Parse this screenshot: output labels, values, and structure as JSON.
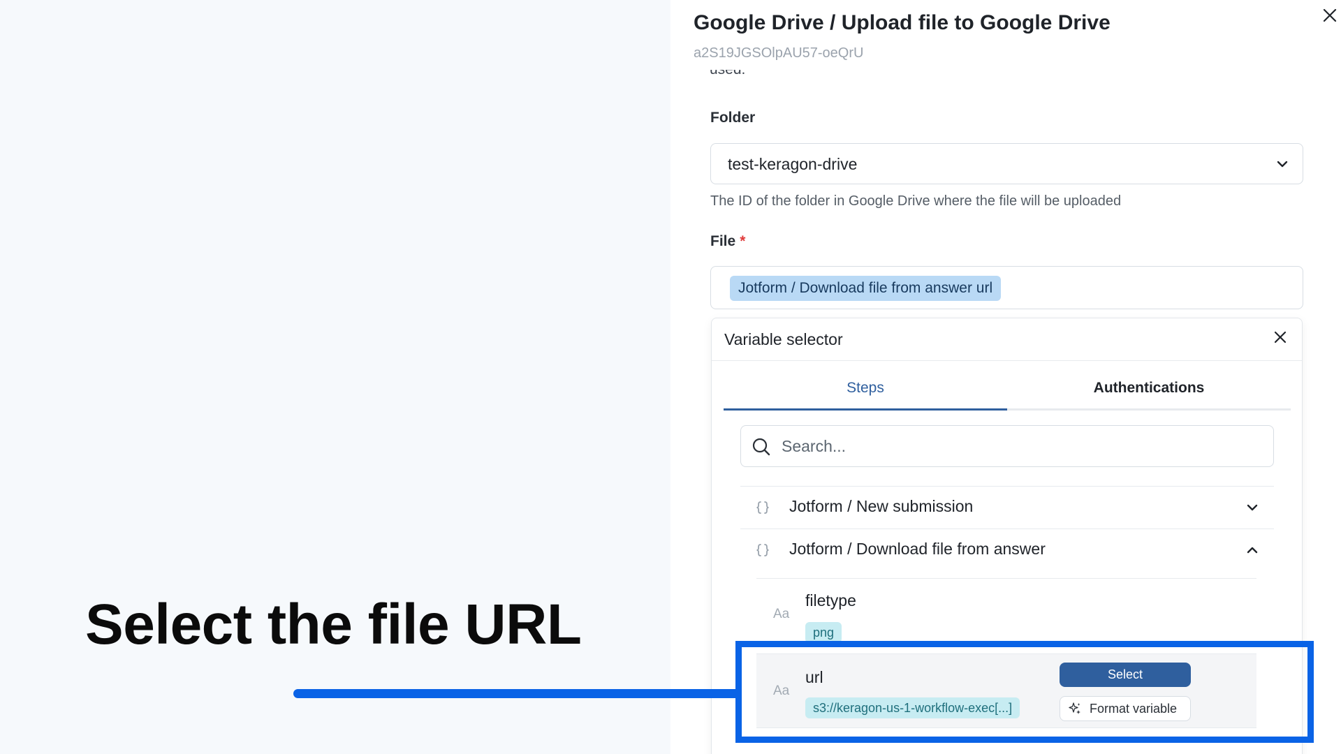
{
  "overlay": {
    "headline": "Select the file URL",
    "accent_color": "#0a63e6"
  },
  "panel": {
    "title": "Google Drive / Upload file to Google Drive",
    "id": "a2S19JGSOlpAU57-oeQrU",
    "cut_text": "used.",
    "close_icon": "close-icon"
  },
  "folder": {
    "label": "Folder",
    "value": "test-keragon-drive",
    "help": "The ID of the folder in Google Drive where the file will be uploaded"
  },
  "file": {
    "label": "File",
    "required_mark": "*",
    "chip": "Jotform / Download file from answer url"
  },
  "variable_selector": {
    "title": "Variable selector",
    "tabs": [
      {
        "label": "Steps",
        "active": true
      },
      {
        "label": "Authentications",
        "active": false
      }
    ],
    "search_placeholder": "Search...",
    "steps": [
      {
        "label": "Jotform / New submission",
        "expanded": false
      },
      {
        "label": "Jotform / Download file from answer",
        "expanded": true
      }
    ],
    "variables": [
      {
        "type_badge": "Aa",
        "name": "filetype",
        "value": "png"
      },
      {
        "type_badge": "Aa",
        "name": "url",
        "value": "s3://keragon-us-1-workflow-exec[...]"
      }
    ],
    "select_label": "Select",
    "format_label": "Format variable"
  }
}
